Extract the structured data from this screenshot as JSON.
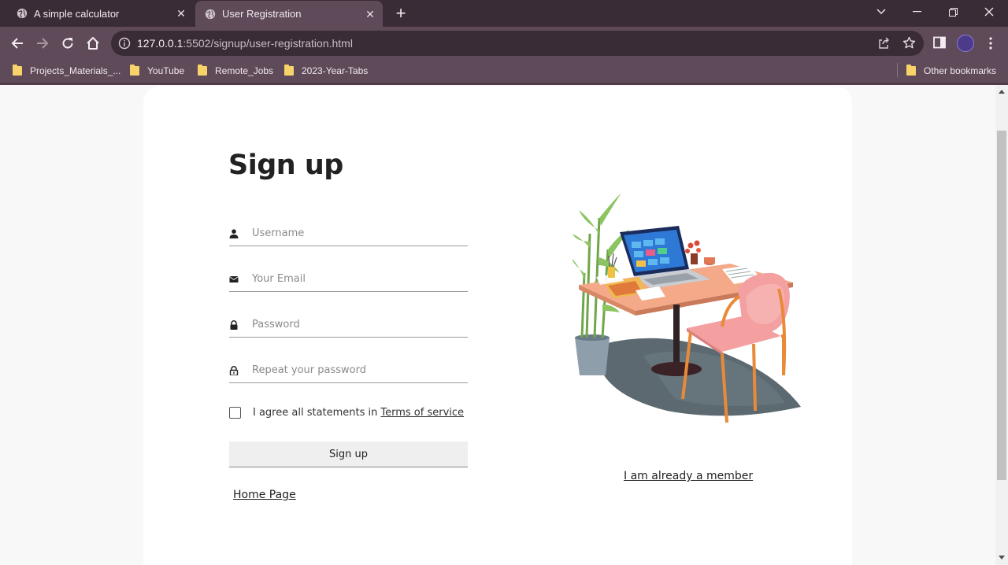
{
  "browser": {
    "tabs": [
      {
        "title": "A simple calculator",
        "icon": "globe-icon",
        "active": false
      },
      {
        "title": "User Registration",
        "icon": "globe-icon",
        "active": true
      }
    ],
    "url_host": "127.0.0.1",
    "url_path": ":5502/signup/user-registration.html",
    "bookmarks": [
      {
        "label": "Projects_Materials_..."
      },
      {
        "label": "YouTube"
      },
      {
        "label": "Remote_Jobs"
      },
      {
        "label": "2023-Year-Tabs"
      }
    ],
    "other_bookmarks": "Other bookmarks",
    "colors": {
      "tabbar": "#3a2c36",
      "toolbar": "#5f4a5a",
      "folder": "#f7d36a"
    }
  },
  "form": {
    "title": "Sign up",
    "fields": [
      {
        "name": "username",
        "placeholder": "Username",
        "icon": "person-icon"
      },
      {
        "name": "email",
        "placeholder": "Your Email",
        "icon": "envelope-icon"
      },
      {
        "name": "password",
        "placeholder": "Password",
        "icon": "lock-icon"
      },
      {
        "name": "repeat_password",
        "placeholder": "Repeat your password",
        "icon": "lock-open-icon"
      }
    ],
    "agree_text": "I agree all statements in",
    "terms_link": "Terms of service",
    "submit_label": "Sign up",
    "home_link": "Home Page"
  },
  "aside": {
    "image": "desk-illustration",
    "member_link": "I am already a member"
  }
}
